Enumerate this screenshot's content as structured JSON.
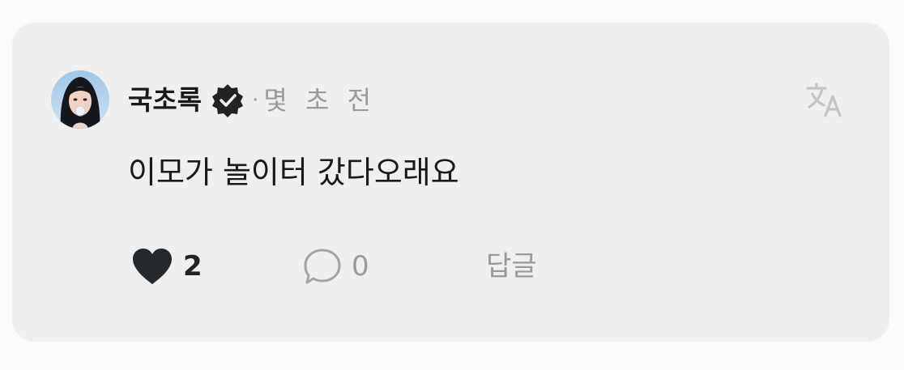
{
  "comment": {
    "author": "국초록",
    "verified": true,
    "separator": "·",
    "timestamp": "몇 초 전",
    "text": "이모가 놀이터 갔다오래요",
    "translate_icon": "translate-icon"
  },
  "actions": {
    "like_icon": "heart-filled-icon",
    "like_count": "2",
    "comment_icon": "speech-bubble-icon",
    "comment_count": "0",
    "reply_label": "답글"
  },
  "colors": {
    "card_background": "#efefef",
    "page_background": "#fbfbfb",
    "primary_text": "#1a1a1a",
    "secondary_text": "#9a9a9a",
    "verified_badge": "#222222"
  }
}
